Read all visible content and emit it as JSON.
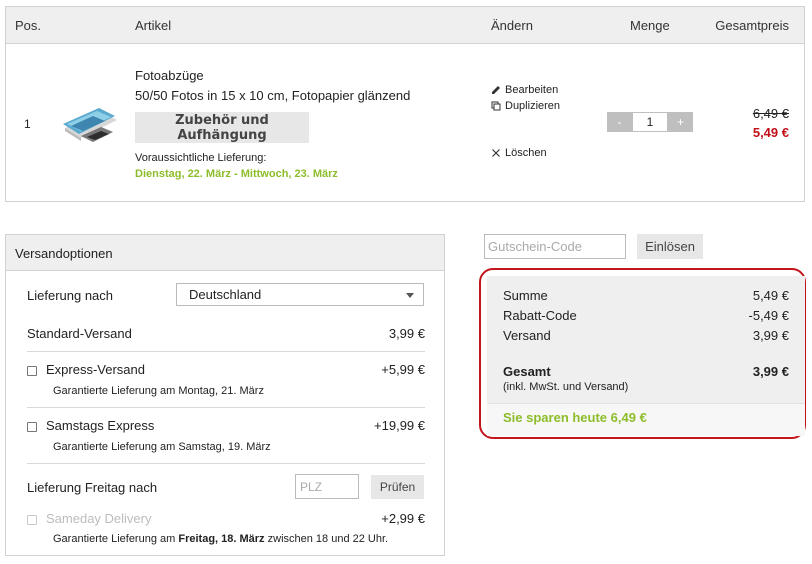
{
  "table_header": {
    "pos": "Pos.",
    "article": "Artikel",
    "change": "Ändern",
    "quantity": "Menge",
    "total": "Gesamtpreis"
  },
  "item": {
    "position": "1",
    "title": "Fotoabzüge",
    "description": "50/50 Fotos in 15 x 10 cm, Fotopapier glänzend",
    "accessories_button": "Zubehör und Aufhängung",
    "delivery_label": "Voraussichtliche Lieferung:",
    "delivery_date": "Dienstag, 22. März - Mittwoch, 23. März",
    "actions": {
      "edit": "Bearbeiten",
      "duplicate": "Duplizieren",
      "delete": "Löschen"
    },
    "quantity": {
      "minus": "-",
      "value": "1",
      "plus": "+"
    },
    "price_old": "6,49 €",
    "price_new": "5,49 €"
  },
  "shipping": {
    "header": "Versandoptionen",
    "destination_label": "Lieferung nach",
    "destination_value": "Deutschland",
    "standard_label": "Standard-Versand",
    "standard_price": "3,99 €",
    "express_label": "Express-Versand",
    "express_price": "+5,99 €",
    "express_note": "Garantierte Lieferung am Montag, 21. März",
    "saturday_label": "Samstags Express",
    "saturday_price": "+19,99 €",
    "saturday_note": "Garantierte Lieferung am Samstag, 19. März",
    "friday_label": "Lieferung Freitag nach",
    "plz_placeholder": "PLZ",
    "check_button": "Prüfen",
    "sameday_label": "Sameday Delivery",
    "sameday_price": "+2,99 €",
    "sameday_note_prefix": "Garantierte Lieferung am ",
    "sameday_note_bold": "Freitag, 18. März",
    "sameday_note_suffix": " zwischen 18 und 22 Uhr."
  },
  "coupon": {
    "placeholder": "Gutschein-Code",
    "redeem_button": "Einlösen"
  },
  "summary": {
    "sum_label": "Summe",
    "sum_value": "5,49 €",
    "discount_label": "Rabatt-Code",
    "discount_value": "-5,49 €",
    "shipping_label": "Versand",
    "shipping_value": "3,99 €",
    "total_label": "Gesamt",
    "total_value": "3,99 €",
    "total_note": "(inkl. MwSt. und Versand)",
    "savings": "Sie sparen heute 6,49 €"
  },
  "colors": {
    "price_red": "#c0101a",
    "delivery_green": "#8dbd2a",
    "highlight_red": "#c3161c"
  }
}
